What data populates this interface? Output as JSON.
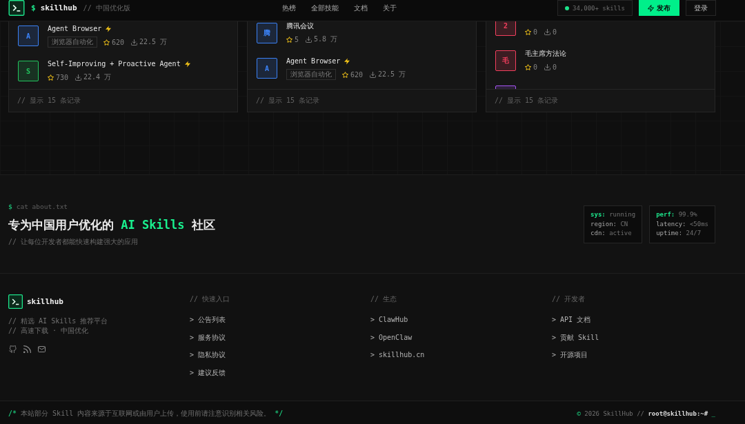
{
  "header": {
    "prompt": "$",
    "brand": "skillhub",
    "tagline": "// 中国优化版",
    "nav": [
      {
        "label": "热榜"
      },
      {
        "label": "全部技能"
      },
      {
        "label": "文档"
      },
      {
        "label": "关于"
      }
    ],
    "online": true,
    "skills_count": "34,000+ skills",
    "publish_button": "发布",
    "login_button": "登录"
  },
  "cards": [
    {
      "items": [
        {
          "avatar": "A",
          "color": "#3b82f6",
          "title": "Agent Browser",
          "featured": true,
          "tag": "浏览器自动化",
          "star_count": "620",
          "download_count": "22.5 万"
        },
        {
          "avatar": "S",
          "color": "#22c55e",
          "title": "Self-Improving + Proactive Agent",
          "featured": true,
          "star_count": "730",
          "download_count": "22.4 万"
        }
      ],
      "footer": "// 显示 15 条记录"
    },
    {
      "items": [
        {
          "avatar": "腾",
          "color": "#3b82f6",
          "title": "腾讯会议",
          "featured": false,
          "star_count": "5",
          "download_count": "5.8 万"
        },
        {
          "avatar": "A",
          "color": "#3b82f6",
          "title": "Agent Browser",
          "featured": true,
          "tag": "浏览器自动化",
          "star_count": "620",
          "download_count": "22.5 万"
        }
      ],
      "footer": "// 显示 15 条记录"
    },
    {
      "items": [
        {
          "avatar": "2",
          "color": "#f43f5e",
          "featured": false,
          "star_count": "0",
          "download_count": "0"
        },
        {
          "avatar": "毛",
          "color": "#f43f5e",
          "title": "毛主席方法论",
          "featured": false,
          "star_count": "0",
          "download_count": "0"
        },
        {
          "color": "#a855f7",
          "featured": false
        }
      ],
      "footer": "// 显示 15 条记录"
    }
  ],
  "about": {
    "prompt": "$",
    "command": "cat about.txt",
    "heading": [
      {
        "text": "专为中国用户优化的",
        "highlight": false
      },
      {
        "text": "AI Skills",
        "highlight": true
      },
      {
        "text": "社区",
        "highlight": false
      }
    ],
    "subtitle": "// 让每位开发者都能快速构建强大的应用",
    "status_panels": [
      {
        "lines": [
          {
            "key": "sys:",
            "value": "running",
            "highlight": true
          },
          {
            "key": "region:",
            "value": "CN",
            "highlight": false
          },
          {
            "key": "cdn:",
            "value": "active",
            "highlight": false
          }
        ]
      },
      {
        "lines": [
          {
            "key": "perf:",
            "value": "99.9%",
            "highlight": true
          },
          {
            "key": "latency:",
            "value": "<50ms",
            "highlight": false
          },
          {
            "key": "uptime:",
            "value": "24/7",
            "highlight": false
          }
        ]
      }
    ]
  },
  "footer": {
    "brand": "skillhub",
    "taglines": [
      "// 精选 AI Skills 推荐平台",
      "// 高速下载 · 中国优化"
    ],
    "social": [
      {
        "kind": "github"
      },
      {
        "kind": "rss"
      },
      {
        "kind": "mail"
      }
    ],
    "columns": [
      {
        "title": "// 快速入口",
        "links": [
          "> 公告列表",
          "> 服务协议",
          "> 隐私协议",
          "> 建议反馈"
        ]
      },
      {
        "title": "// 生态",
        "links": [
          "> ClawHub",
          "> OpenClaw",
          "> skillhub.cn"
        ]
      },
      {
        "title": "// 开发者",
        "links": [
          "> API 文档",
          "> 贡献 Skill",
          "> 开源项目"
        ]
      }
    ]
  },
  "bottom_bar": {
    "notice": [
      {
        "text": "/*",
        "accent": true
      },
      {
        "text": "本站部分 Skill 内容来源于互联网或由用户上传，使用前请注意识别相关风险。",
        "accent": false
      },
      {
        "text": "*/",
        "accent": true
      }
    ],
    "copyright": [
      {
        "text": "©",
        "kind": "accent"
      },
      {
        "text": "2026 SkillHub //",
        "kind": "muted"
      },
      {
        "text": "root@skillhub:~#",
        "kind": "strong"
      },
      {
        "text": "_",
        "kind": "accent"
      }
    ]
  }
}
